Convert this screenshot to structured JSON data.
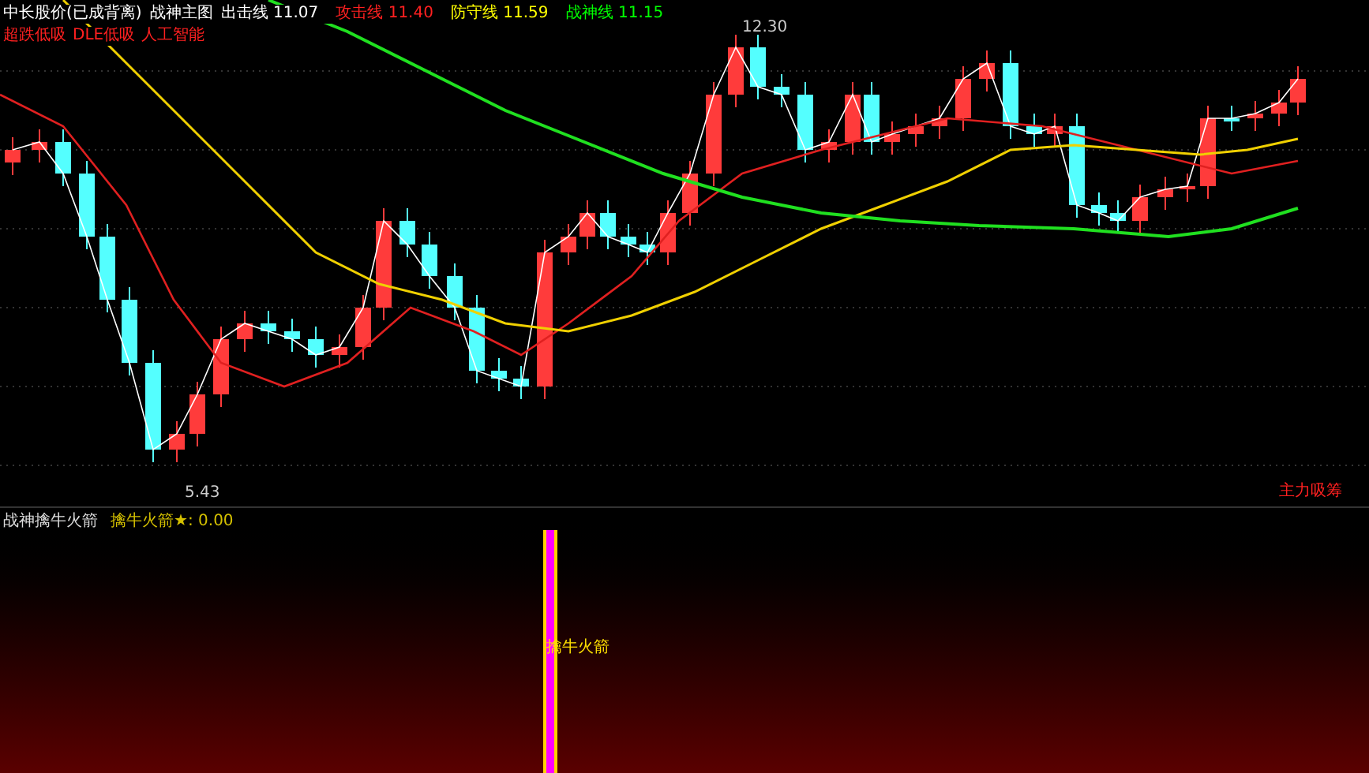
{
  "header": {
    "title": "中长股价(已成背离)",
    "indicator": "战神主图",
    "lines": [
      {
        "label": "出击线",
        "value": "11.07",
        "color": "#ffffff"
      },
      {
        "label": "攻击线",
        "value": "11.40",
        "color": "#ff2020"
      },
      {
        "label": "防守线",
        "value": "11.59",
        "color": "#ffff00"
      },
      {
        "label": "战神线",
        "value": "11.15",
        "color": "#00ff00"
      }
    ]
  },
  "tags": [
    "超跌低吸",
    "DLE低吸",
    "人工智能"
  ],
  "price_labels": {
    "high": "12.30",
    "low": "5.43"
  },
  "signal_label": "主力吸筹",
  "sub_panel": {
    "title": "战神擒牛火箭",
    "reading_label": "擒牛火箭★:",
    "reading_value": "0.00",
    "marker": "擒牛火箭"
  }
}
